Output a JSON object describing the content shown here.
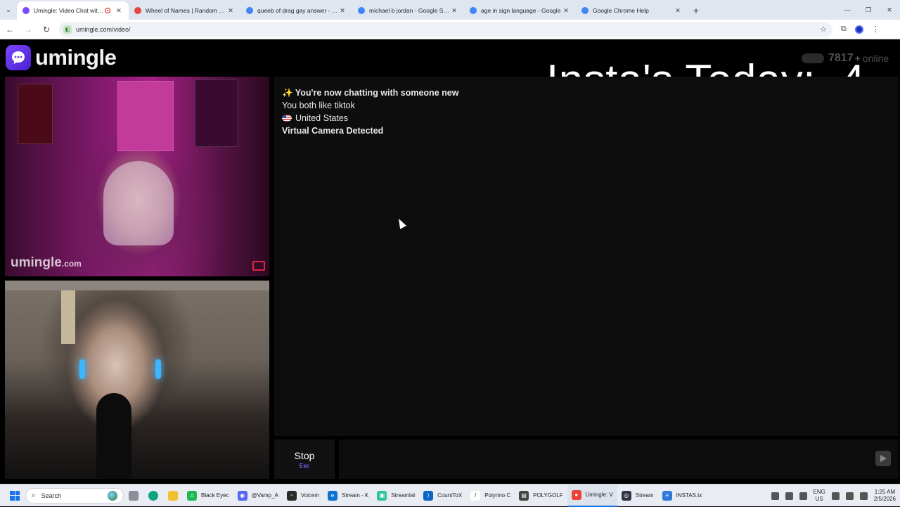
{
  "browser": {
    "tabs": [
      {
        "title": "Umingle: Video Chat with S",
        "active": true,
        "favicon_color": "#7b47ff",
        "recording": true
      },
      {
        "title": "Wheel of Names | Random nam",
        "active": false,
        "favicon_color": "#e8453c"
      },
      {
        "title": "queeb of drag gay answer - Go",
        "active": false,
        "favicon_color": "#4285f4"
      },
      {
        "title": "michael b jordan - Google Sear",
        "active": false,
        "favicon_color": "#4285f4"
      },
      {
        "title": "age in sign language - Google",
        "active": false,
        "favicon_color": "#4285f4"
      },
      {
        "title": "Google Chrome Help",
        "active": false,
        "favicon_color": "#4285f4"
      }
    ],
    "new_tab_label": "+",
    "address": "umingle.com/video/"
  },
  "site": {
    "logo_text": "umingle",
    "online_count": "7817",
    "online_plus": "+",
    "online_label": "online",
    "overlay_text": "Insta's Today:  4",
    "remote_watermark": "umingle",
    "remote_watermark_domain": ".com"
  },
  "chat": {
    "lines": [
      {
        "text": "✨ You're now chatting with someone new",
        "bold": true
      },
      {
        "text": "You both like tiktok",
        "bold": false
      },
      {
        "text": "United States",
        "bold": false,
        "flag": true
      },
      {
        "text": "Virtual Camera Detected",
        "bold": true
      }
    ],
    "stop_label": "Stop",
    "stop_key": "Esc",
    "message_value": ""
  },
  "taskbar": {
    "search_placeholder": "Search",
    "apps": [
      {
        "label": "Black Eyec",
        "color": "#1db954",
        "glyph": "♫"
      },
      {
        "label": "@Vamp_A",
        "color": "#5865f2",
        "glyph": "◉"
      },
      {
        "label": "Voicem",
        "color": "#2b2b2b",
        "glyph": "~"
      },
      {
        "label": "Stream - K",
        "color": "#0b74d1",
        "glyph": "e"
      },
      {
        "label": "Streamlal",
        "color": "#31c3a2",
        "glyph": "▣"
      },
      {
        "label": "CountToX",
        "color": "#0a66c2",
        "glyph": "⟩"
      },
      {
        "label": "Polyrino C",
        "color": "#ffffff",
        "glyph": "/"
      },
      {
        "label": "POLYGOLF",
        "color": "#444444",
        "glyph": "▤"
      },
      {
        "label": "Umingle: V",
        "color": "#ea4335",
        "glyph": "●",
        "active": true
      },
      {
        "label": "Stream",
        "color": "#333344",
        "glyph": "◎"
      },
      {
        "label": "INSTAS.tx",
        "color": "#2f7ad8",
        "glyph": "≡"
      }
    ],
    "lang_top": "ENG",
    "lang_bottom": "US",
    "time": "1:25 AM",
    "date": "2/5/2026"
  },
  "colors": {
    "accent": "#7b47ff",
    "page_bg": "#000000",
    "chat_bg": "#0d0d0d",
    "report": "#e0263b"
  }
}
